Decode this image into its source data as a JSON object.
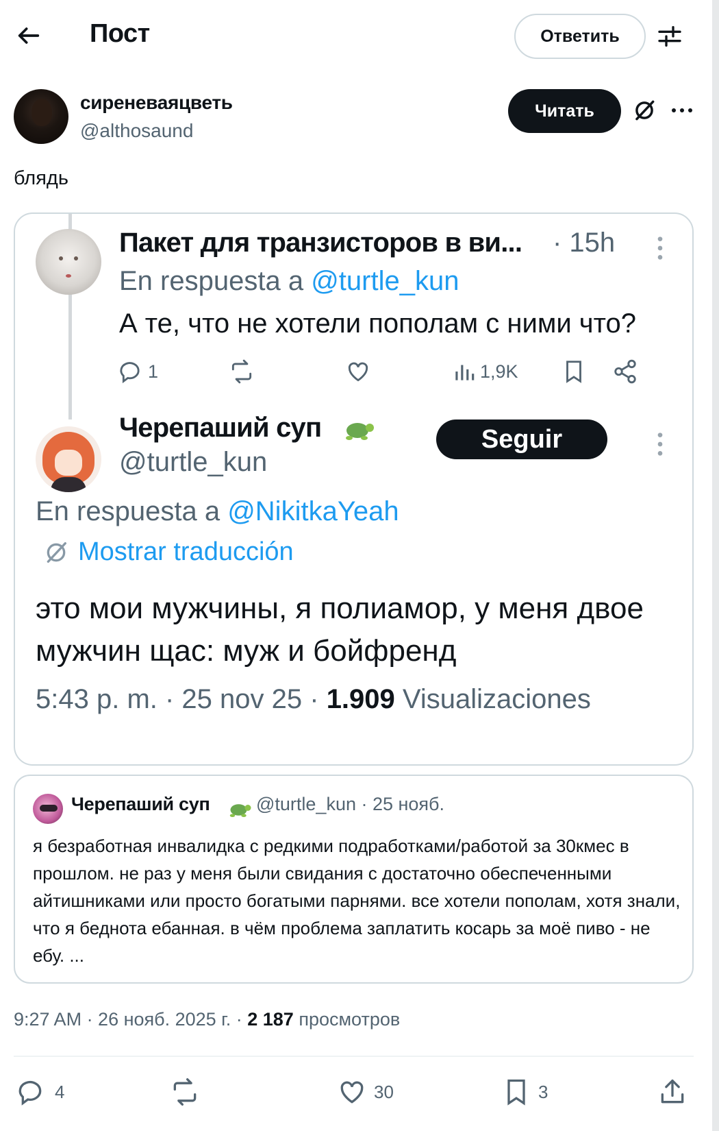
{
  "header": {
    "title": "Пост",
    "reply_label": "Ответить"
  },
  "author": {
    "name": "сиреневаяцветь",
    "handle": "@althosaund",
    "follow_label": "Читать"
  },
  "post": {
    "text": "блядь"
  },
  "screenshot": {
    "tweet1": {
      "name": "Пакет для транзисторов в ви...",
      "meta": "· 15h",
      "reply_prefix": "En respuesta a",
      "reply_to": "@turtle_kun",
      "text": "А те, что не хотели пополам с ними что?",
      "replies": "1",
      "views": "1,9K"
    },
    "tweet2": {
      "name": "Черепаший суп",
      "handle": "@turtle_kun",
      "follow_label": "Seguir",
      "reply_prefix": "En respuesta a",
      "reply_to": "@NikitkaYeah",
      "translate_label": "Mostrar traducción",
      "text": "это мои мужчины, я полиамор, у меня двое мужчин щас: муж и бойфренд",
      "meta_prefix": "5:43 p. m. · 25 nov 25 ·",
      "views_count": "1.909",
      "views_label": "Visualizaciones"
    }
  },
  "quote": {
    "name": "Черепаший суп",
    "meta": "@turtle_kun · 25 нояб.",
    "text": "я безработная инвалидка с редкими подработками/работой за 30кмес в прошлом. не раз у меня были свидания с достаточно обеспеченными айтишниками или просто богатыми парнями. все хотели пополам, хотя знали, что я беднота ебанная. в чём проблема заплатить косарь за моё пиво - не ебу. ..."
  },
  "timestamp": {
    "prefix": "9:27 AM · 26 нояб. 2025 г. ·",
    "views_count": "2 187",
    "views_label": "просмотров"
  },
  "actions": {
    "replies": "4",
    "likes": "30",
    "bookmarks": "3"
  },
  "colors": {
    "accent": "#1d9bf0",
    "text": "#0f1419",
    "muted": "#536471",
    "border": "#cfd9de"
  }
}
